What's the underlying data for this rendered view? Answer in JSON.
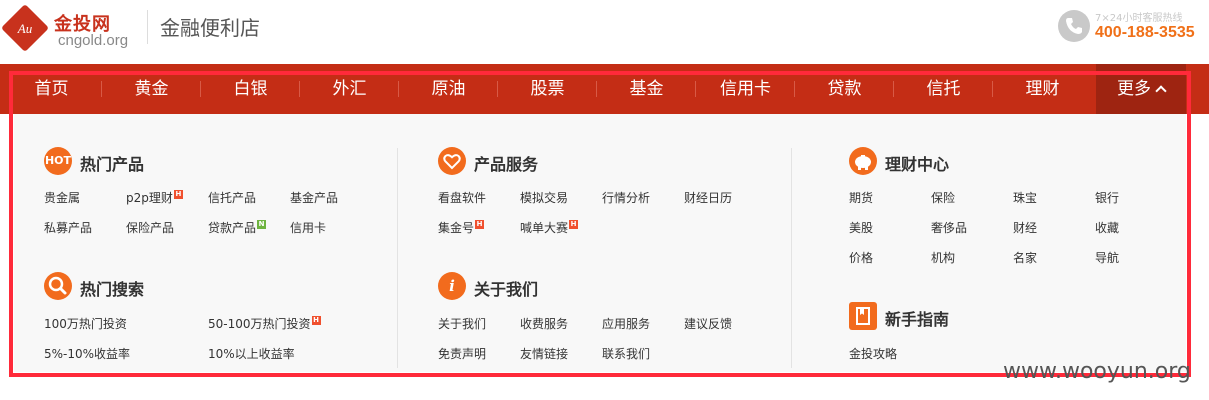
{
  "header": {
    "logo_cn": "金投网",
    "logo_en": "cngold.org",
    "logo_mark": "Au",
    "site_title": "金融便利店",
    "hotline_label": "7×24小时客服热线",
    "hotline_number": "400-188-3535",
    "phone_icon": "phone-icon"
  },
  "nav": {
    "items": [
      "首页",
      "黄金",
      "白银",
      "外汇",
      "原油",
      "股票",
      "基金",
      "信用卡",
      "贷款",
      "信托",
      "理财"
    ],
    "more_label": "更多"
  },
  "hot_products": {
    "title": "热门产品",
    "icon_text": "HOT",
    "links": [
      "贵金属",
      "p2p理财",
      "信托产品",
      "基金产品",
      "私募产品",
      "保险产品",
      "贷款产品",
      "信用卡"
    ],
    "tag_h": "H",
    "tag_n": "N"
  },
  "hot_search": {
    "title": "热门搜索",
    "links": [
      "100万热门投资",
      "50-100万热门投资",
      "5%-10%收益率",
      "10%以上收益率"
    ]
  },
  "product_services": {
    "title": "产品服务",
    "links": [
      "看盘软件",
      "模拟交易",
      "行情分析",
      "财经日历",
      "集金号",
      "喊单大赛"
    ]
  },
  "about_us": {
    "title": "关于我们",
    "icon_text": "i",
    "links": [
      "关于我们",
      "收费服务",
      "应用服务",
      "建议反馈",
      "免责声明",
      "友情链接",
      "联系我们"
    ]
  },
  "finance_center": {
    "title": "理财中心",
    "links": [
      "期货",
      "保险",
      "珠宝",
      "银行",
      "美股",
      "奢侈品",
      "财经",
      "收藏",
      "价格",
      "机构",
      "名家",
      "导航"
    ]
  },
  "beginner_guide": {
    "title": "新手指南",
    "links": [
      "金投攻略"
    ]
  },
  "watermark": "www.wooyun.org",
  "colors": {
    "brand_red": "#c42d15",
    "accent_orange": "#f26b1d",
    "highlight_red": "#ff2a3a"
  }
}
